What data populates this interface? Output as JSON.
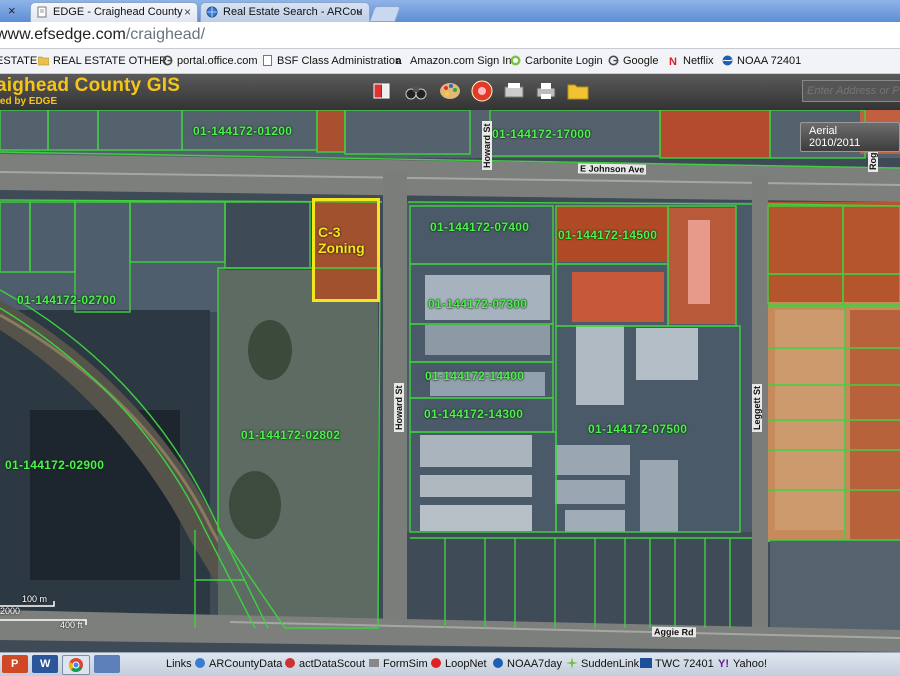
{
  "browser": {
    "tabs": [
      {
        "label": "EDGE - Craighead County",
        "close": "×"
      },
      {
        "label": "Real Estate Search - ARCou",
        "close": "×"
      }
    ],
    "left_close": "×",
    "address": {
      "host": "www.efsedge.com",
      "path": "/craighead/"
    },
    "bookmarks": [
      {
        "label": "ESTATE",
        "icon": "folder-icon"
      },
      {
        "label": "REAL ESTATE OTHER",
        "icon": "folder-icon"
      },
      {
        "label": "portal.office.com",
        "icon": "google-icon"
      },
      {
        "label": "BSF Class Administration",
        "icon": "page-icon"
      },
      {
        "label": "Amazon.com Sign In",
        "icon": "amazon-icon"
      },
      {
        "label": "Carbonite Login",
        "icon": "carbonite-icon"
      },
      {
        "label": "Google",
        "icon": "google-icon"
      },
      {
        "label": "Netflix",
        "icon": "netflix-icon"
      },
      {
        "label": "NOAA 72401",
        "icon": "noaa-icon"
      }
    ]
  },
  "gis": {
    "title": "aighead County GIS",
    "subtitle": "red by EDGE",
    "search_placeholder": "Enter Address or Pa",
    "aerial_button": "Aerial 2010/2011",
    "zoning_label_1": "C-3",
    "zoning_label_2": "Zoning",
    "scale": {
      "meters": "100 m",
      "feet": "400 ft",
      "partial": "2000"
    },
    "parcels": [
      "01-144172-01200",
      "01-144172-17000",
      "01-144172-07400",
      "01-144172-14500",
      "01-144172-02700",
      "01-144172-07300",
      "01-144172-14400",
      "01-144172-14300",
      "01-144172-07500",
      "01-144172-02802",
      "01-144172-02900"
    ],
    "streets": {
      "johnson": "E Johnson Ave",
      "howard_top": "Howard St",
      "howard": "Howard St",
      "leggett": "Leggett St",
      "aggie": "Aggie Rd",
      "roger": "Roge"
    }
  },
  "taskbar": {
    "links_label": "Links",
    "items": [
      {
        "label": "ARCountyData",
        "icon": "globe-icon"
      },
      {
        "label": "actDataScout",
        "icon": "scout-icon"
      },
      {
        "label": "FormSim",
        "icon": "formsim-icon"
      },
      {
        "label": "LoopNet",
        "icon": "loopnet-icon"
      },
      {
        "label": "NOAA7day",
        "icon": "noaa-icon"
      },
      {
        "label": "SuddenLink",
        "icon": "suddenlink-icon"
      },
      {
        "label": "TWC 72401",
        "icon": "twc-icon"
      },
      {
        "label": "Yahoo!",
        "icon": "yahoo-icon"
      }
    ]
  },
  "colors": {
    "parcel_outline": "#3fd13f",
    "label_green": "#4ef24e",
    "zoning_yellow": "#f3e61f",
    "gis_title": "#f5c518",
    "commercial_overlay": "#c0522b",
    "residential_overlay": "#c98a55"
  }
}
